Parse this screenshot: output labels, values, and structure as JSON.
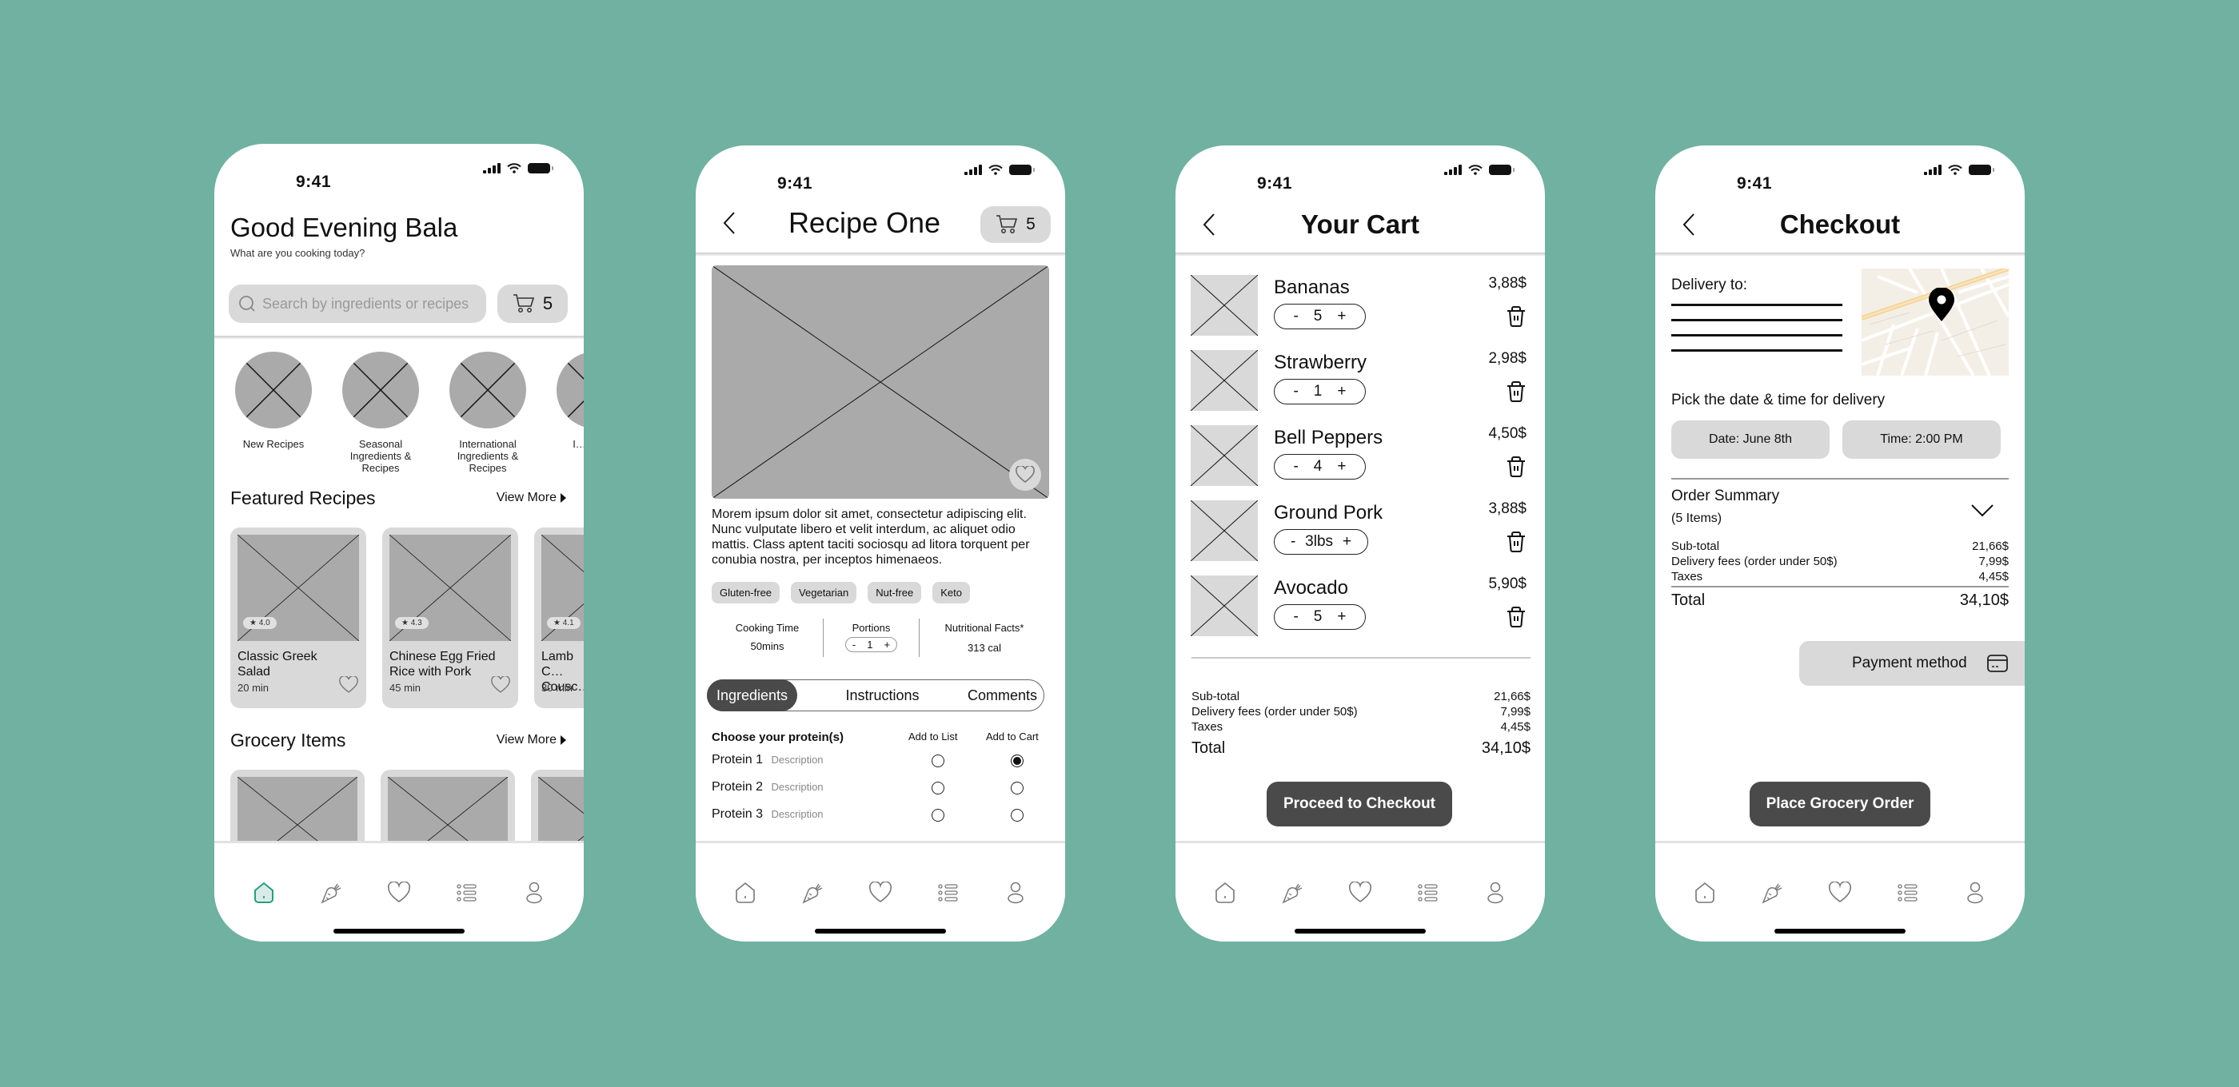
{
  "status_time": "9:41",
  "colors": {
    "background": "#70b1a1",
    "accent": "#2a9d7f",
    "dark_button": "#4a4a4a",
    "placeholder": "#aaaaaa",
    "pill": "#d9d9d9"
  },
  "tabbar": {
    "items": [
      {
        "icon": "home-icon"
      },
      {
        "icon": "carrot-icon"
      },
      {
        "icon": "heart-icon"
      },
      {
        "icon": "list-icon"
      },
      {
        "icon": "profile-icon"
      }
    ]
  },
  "home": {
    "greeting": "Good Evening Bala",
    "subtitle": "What are you cooking today?",
    "search_placeholder": "Search by ingredients or recipes",
    "cart_count": "5",
    "categories": [
      {
        "label": "New Recipes"
      },
      {
        "label": "Seasonal Ingredients & Recipes"
      },
      {
        "label": "International Ingredients & Recipes"
      },
      {
        "label": "I… Ingr…"
      }
    ],
    "featured_title": "Featured Recipes",
    "view_more": "View More",
    "featured": [
      {
        "title": "Classic Greek Salad",
        "time": "20 min",
        "rating": "4.0"
      },
      {
        "title": "Chinese Egg Fried Rice with Pork",
        "time": "45 min",
        "rating": "4.3"
      },
      {
        "title": "Lamb C… Cousc…",
        "time": "30 min",
        "rating": "4.1"
      }
    ],
    "grocery_title": "Grocery Items",
    "grocery_view_more": "View More"
  },
  "recipe": {
    "title": "Recipe One",
    "cart_count": "5",
    "description": "Morem ipsum dolor sit amet, consectetur adipiscing elit. Nunc vulputate libero et velit interdum, ac aliquet odio mattis. Class aptent taciti sociosqu ad litora torquent per conubia nostra, per inceptos himenaeos.",
    "tags": [
      "Gluten-free",
      "Vegetarian",
      "Nut-free",
      "Keto"
    ],
    "stats": {
      "cooking_label": "Cooking Time",
      "cooking_value": "50mins",
      "portions_label": "Portions",
      "portions_value": "1",
      "nutrition_label": "Nutritional Facts*",
      "nutrition_value": "313 cal"
    },
    "tabs": [
      "Ingredients",
      "Instructions",
      "Comments"
    ],
    "active_tab": "Ingredients",
    "protein_heading": "Choose your protein(s)",
    "col_list": "Add to List",
    "col_cart": "Add to Cart",
    "proteins": [
      {
        "name": "Protein 1",
        "desc": "Description",
        "list": false,
        "cart": true
      },
      {
        "name": "Protein 2",
        "desc": "Description",
        "list": false,
        "cart": false
      },
      {
        "name": "Protein 3",
        "desc": "Description",
        "list": false,
        "cart": false
      }
    ]
  },
  "cart": {
    "title": "Your Cart",
    "items": [
      {
        "name": "Bananas",
        "qty": "5",
        "price": "3,88$"
      },
      {
        "name": "Strawberry",
        "qty": "1",
        "price": "2,98$"
      },
      {
        "name": "Bell Peppers",
        "qty": "4",
        "price": "4,50$"
      },
      {
        "name": "Ground Pork",
        "qty": "3lbs",
        "price": "3,88$"
      },
      {
        "name": "Avocado",
        "qty": "5",
        "price": "5,90$"
      }
    ],
    "subtotal_label": "Sub-total",
    "subtotal": "21,66$",
    "delivery_label": "Delivery fees (order under 50$)",
    "delivery": "7,99$",
    "taxes_label": "Taxes",
    "taxes": "4,45$",
    "total_label": "Total",
    "total": "34,10$",
    "proceed_label": "Proceed to Checkout"
  },
  "checkout": {
    "title": "Checkout",
    "delivery_to": "Delivery to:",
    "pick_label": "Pick the date & time for delivery",
    "date_button": "Date: June 8th",
    "time_button": "Time: 2:00 PM",
    "order_summary": "Order Summary",
    "items_count": "(5 Items)",
    "subtotal_label": "Sub-total",
    "subtotal": "21,66$",
    "delivery_label": "Delivery fees (order under 50$)",
    "delivery": "7,99$",
    "taxes_label": "Taxes",
    "taxes": "4,45$",
    "total_label": "Total",
    "total": "34,10$",
    "payment_label": "Payment method",
    "place_order_label": "Place Grocery Order"
  }
}
